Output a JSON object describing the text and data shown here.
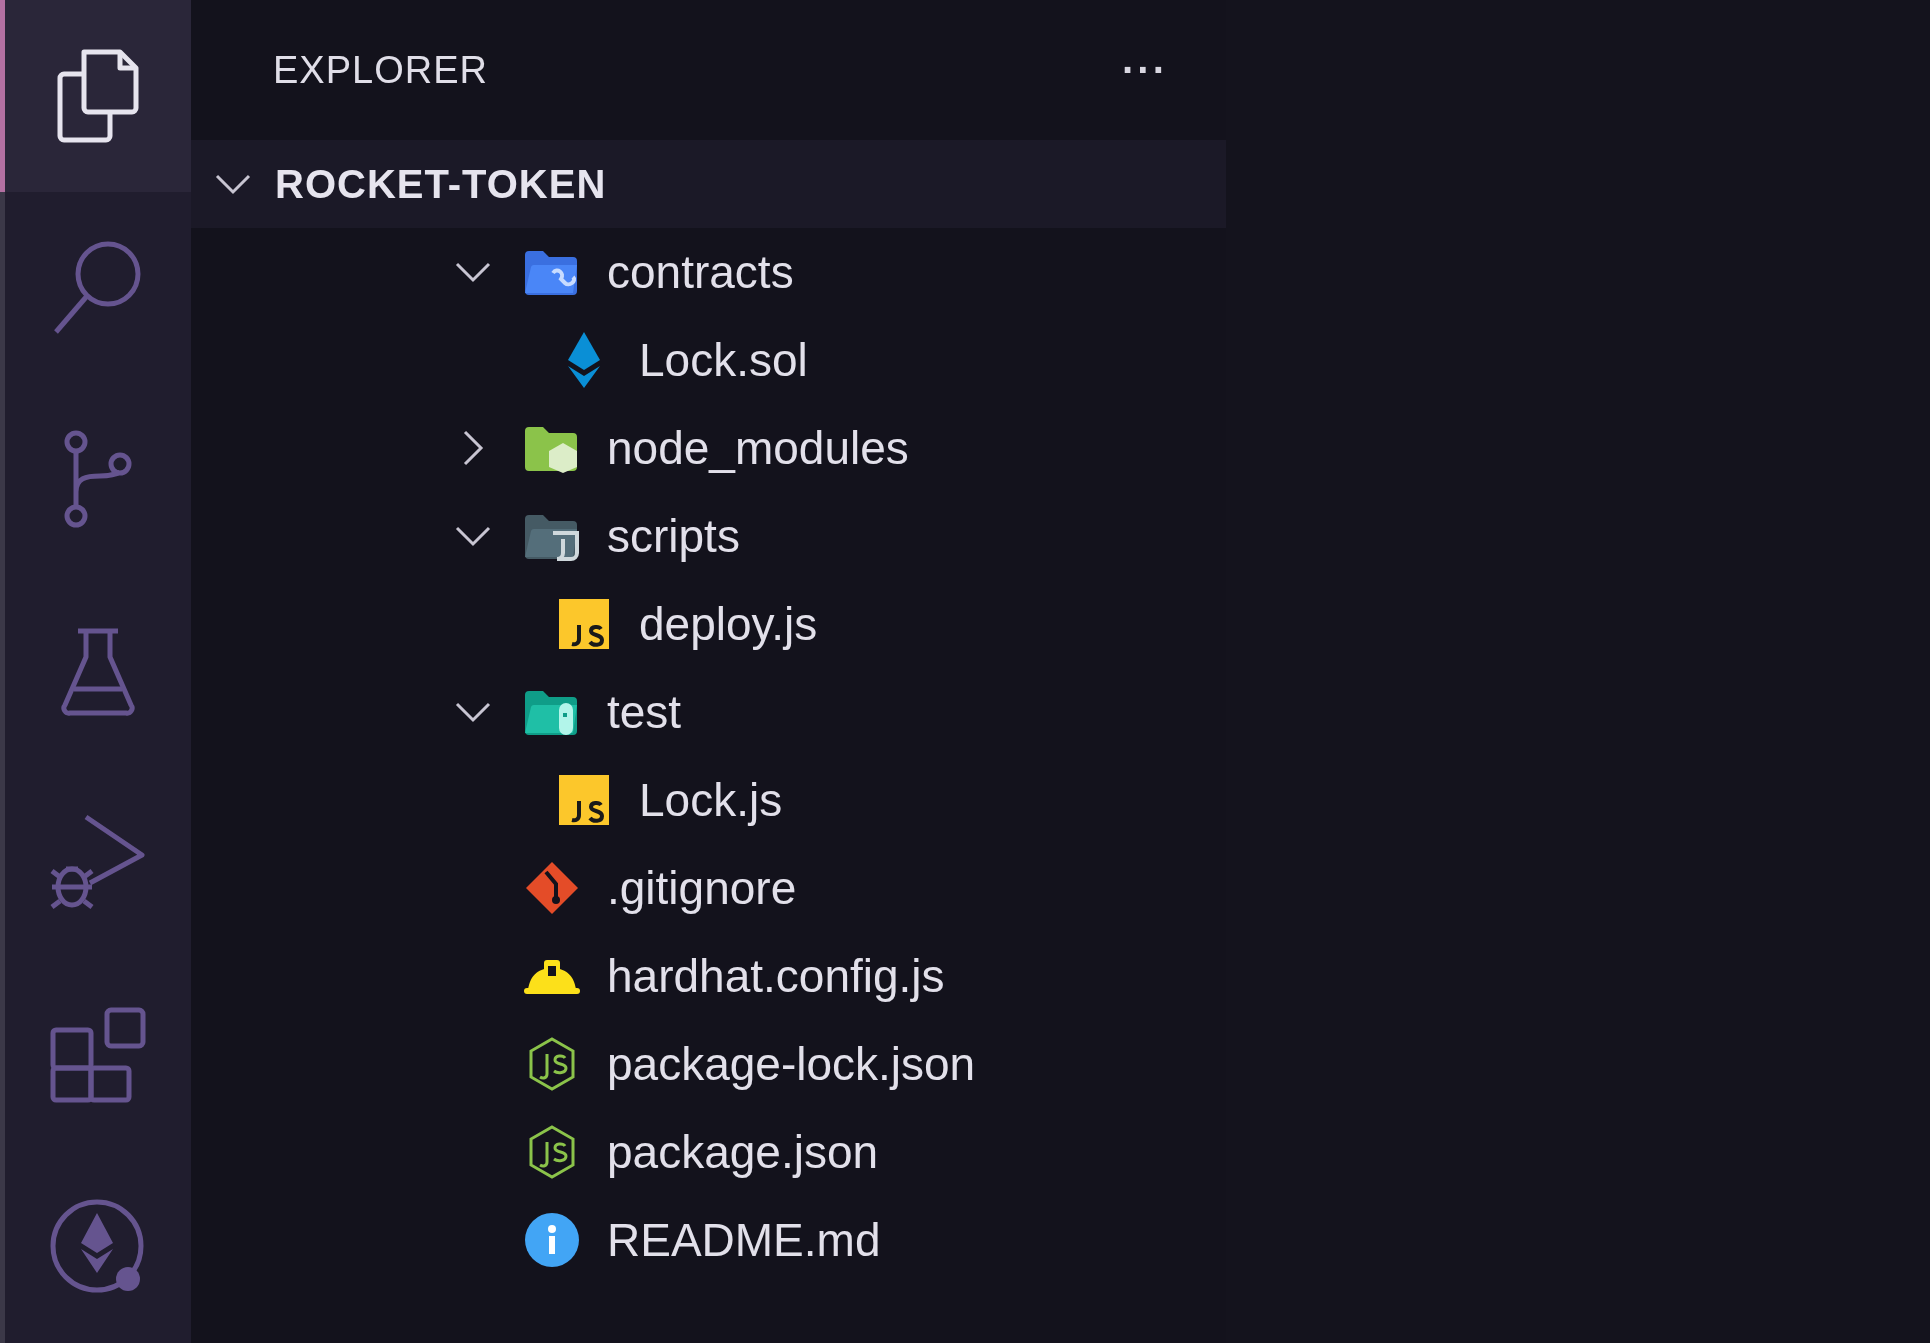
{
  "activity_bar": [
    {
      "kind": "files",
      "selected": true
    },
    {
      "kind": "search",
      "selected": false
    },
    {
      "kind": "source-control",
      "selected": false
    },
    {
      "kind": "testing",
      "selected": false
    },
    {
      "kind": "run-debug",
      "selected": false
    },
    {
      "kind": "extensions",
      "selected": false
    },
    {
      "kind": "ethereum",
      "selected": false
    }
  ],
  "sidebar": {
    "title": "EXPLORER",
    "more": "···",
    "root": {
      "label": "ROCKET-TOKEN",
      "expanded": true,
      "children": [
        {
          "label": "contracts",
          "kind": "contracts-folder",
          "expanded": true,
          "children": [
            {
              "label": "Lock.sol",
              "kind": "solidity-file"
            }
          ]
        },
        {
          "label": "node_modules",
          "kind": "node-folder",
          "expanded": false
        },
        {
          "label": "scripts",
          "kind": "scripts-folder",
          "expanded": true,
          "children": [
            {
              "label": "deploy.js",
              "kind": "js-file"
            }
          ]
        },
        {
          "label": "test",
          "kind": "test-folder",
          "expanded": true,
          "children": [
            {
              "label": "Lock.js",
              "kind": "js-file"
            }
          ]
        },
        {
          "label": ".gitignore",
          "kind": "git-file"
        },
        {
          "label": "hardhat.config.js",
          "kind": "hardhat-file"
        },
        {
          "label": "package-lock.json",
          "kind": "node-file"
        },
        {
          "label": "package.json",
          "kind": "node-file"
        },
        {
          "label": "README.md",
          "kind": "info-file"
        }
      ]
    }
  }
}
